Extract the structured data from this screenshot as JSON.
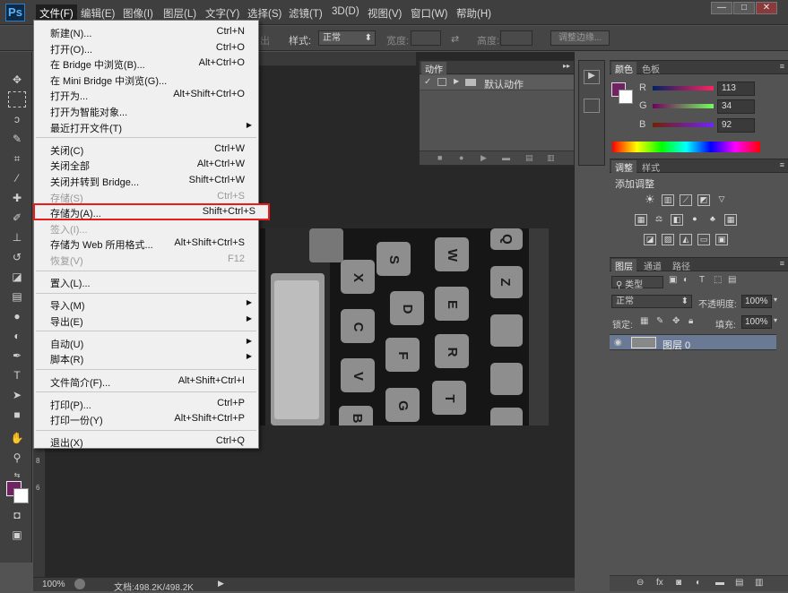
{
  "menubar": {
    "logo": "Ps",
    "items": [
      "文件(F)",
      "编辑(E)",
      "图像(I)",
      "图层(L)",
      "文字(Y)",
      "选择(S)",
      "滤镜(T)",
      "3D(D)",
      "视图(V)",
      "窗口(W)",
      "帮助(H)"
    ],
    "window_buttons": [
      "—",
      "□",
      "✕"
    ]
  },
  "options": {
    "style_label": "样式:",
    "style_value": "正常",
    "width_label": "宽度:",
    "height_label": "高度:",
    "refine_button": "调整边缘..."
  },
  "file_menu": {
    "groups": [
      [
        {
          "label": "新建(N)...",
          "shortcut": "Ctrl+N"
        },
        {
          "label": "打开(O)...",
          "shortcut": "Ctrl+O"
        },
        {
          "label": "在 Bridge 中浏览(B)...",
          "shortcut": "Alt+Ctrl+O"
        },
        {
          "label": "在 Mini Bridge 中浏览(G)...",
          "shortcut": ""
        },
        {
          "label": "打开为...",
          "shortcut": "Alt+Shift+Ctrl+O"
        },
        {
          "label": "打开为智能对象...",
          "shortcut": ""
        },
        {
          "label": "最近打开文件(T)",
          "shortcut": "",
          "submenu": true
        }
      ],
      [
        {
          "label": "关闭(C)",
          "shortcut": "Ctrl+W"
        },
        {
          "label": "关闭全部",
          "shortcut": "Alt+Ctrl+W"
        },
        {
          "label": "关闭并转到 Bridge...",
          "shortcut": "Shift+Ctrl+W"
        },
        {
          "label": "存储(S)",
          "shortcut": "Ctrl+S",
          "disabled": true
        },
        {
          "label": "存储为(A)...",
          "shortcut": "Shift+Ctrl+S",
          "highlight": true
        },
        {
          "label": "签入(I)...",
          "shortcut": "",
          "disabled": true
        },
        {
          "label": "存储为 Web 所用格式...",
          "shortcut": "Alt+Shift+Ctrl+S"
        },
        {
          "label": "恢复(V)",
          "shortcut": "F12",
          "disabled": true
        }
      ],
      [
        {
          "label": "置入(L)...",
          "shortcut": ""
        }
      ],
      [
        {
          "label": "导入(M)",
          "shortcut": "",
          "submenu": true
        },
        {
          "label": "导出(E)",
          "shortcut": "",
          "submenu": true
        }
      ],
      [
        {
          "label": "自动(U)",
          "shortcut": "",
          "submenu": true
        },
        {
          "label": "脚本(R)",
          "shortcut": "",
          "submenu": true
        }
      ],
      [
        {
          "label": "文件简介(F)...",
          "shortcut": "Alt+Shift+Ctrl+I"
        }
      ],
      [
        {
          "label": "打印(P)...",
          "shortcut": "Ctrl+P"
        },
        {
          "label": "打印一份(Y)",
          "shortcut": "Alt+Shift+Ctrl+P"
        }
      ],
      [
        {
          "label": "退出(X)",
          "shortcut": "Ctrl+Q"
        }
      ]
    ]
  },
  "actions_panel": {
    "tab": "动作",
    "item": "默认动作"
  },
  "color_panel": {
    "tabs": [
      "颜色",
      "色板"
    ],
    "r_label": "R",
    "g_label": "G",
    "b_label": "B",
    "r": "113",
    "g": "34",
    "b": "92",
    "foreground": "#712262"
  },
  "adjust_panel": {
    "tabs": [
      "调整",
      "样式"
    ],
    "title": "添加调整"
  },
  "layers_panel": {
    "tabs": [
      "图层",
      "通道",
      "路径"
    ],
    "filter_label": "类型",
    "blend_mode": "正常",
    "opacity_label": "不透明度:",
    "opacity": "100%",
    "lock_label": "锁定:",
    "fill_label": "填充:",
    "fill": "100%",
    "layer_name": "图层 0"
  },
  "statusbar": {
    "zoom": "100%",
    "doc_info": "文档:498.2K/498.2K"
  },
  "ruler": {
    "numbers": [
      "8",
      "6"
    ]
  },
  "keyboard_keys": [
    "S",
    "W",
    "X",
    "D",
    "E",
    "C",
    "F",
    "R",
    "V",
    "G",
    "T",
    "B",
    "Q",
    "Z"
  ]
}
